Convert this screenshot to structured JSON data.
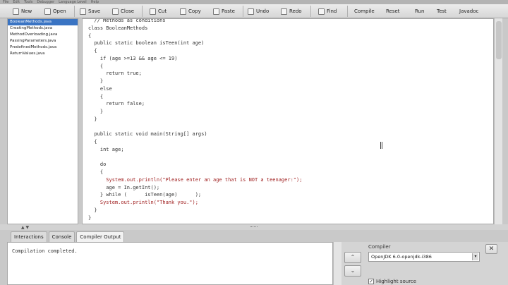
{
  "menubar": {
    "items": [
      "File",
      "Edit",
      "Tools",
      "Debugger",
      "Language Level",
      "Help"
    ]
  },
  "toolbar": {
    "new": "New",
    "open": "Open",
    "save": "Save",
    "close": "Close",
    "cut": "Cut",
    "copy": "Copy",
    "paste": "Paste",
    "undo": "Undo",
    "redo": "Redo",
    "find": "Find",
    "compile": "Compile",
    "reset": "Reset",
    "run": "Run",
    "test": "Test",
    "javadoc": "Javadoc"
  },
  "files": [
    "BooleanMethods.java",
    "CreatingMethods.java",
    "MethodOverloading.java",
    "PassingParameters.java",
    "PredefinedMethods.java",
    "ReturnValues.java"
  ],
  "code": [
    "  // Methods as conditions",
    "class BooleanMethods",
    "{",
    "  public static boolean isTeen(int age)",
    "  {",
    "    if (age >=13 && age <= 19)",
    "    {",
    "      return true;",
    "    }",
    "    else",
    "    {",
    "      return false;",
    "    }",
    "  }",
    "",
    "  public static void main(String[] args)",
    "  {",
    "    int age;",
    "",
    "    do",
    "    {",
    "      System.out.println(\"Please enter an age that is NOT a teenager:\");",
    "      age = In.getInt();",
    "    } while (      isTeen(age)      );",
    "    System.out.println(\"Thank you.\");",
    "  }",
    "}"
  ],
  "tabs": {
    "interactions": "Interactions",
    "console": "Console",
    "compiler_output": "Compiler Output"
  },
  "output": {
    "text": "Compilation completed."
  },
  "compiler": {
    "label": "Compiler",
    "selected": "OpenJDK 6.0-openjdk-i386"
  },
  "highlight": {
    "label": "Highlight source",
    "checked": true
  },
  "colors": {
    "selection": "#3a74c3",
    "string": "#a02020"
  }
}
